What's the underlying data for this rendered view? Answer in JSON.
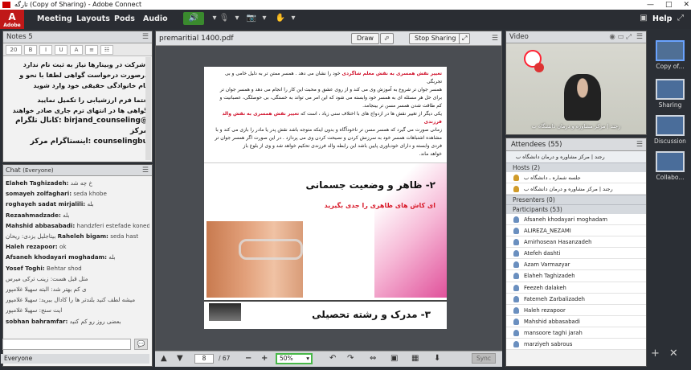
{
  "window": {
    "title": "تارگه (Copy of Sharing) - Adobe Connect",
    "controls": [
      "—",
      "□",
      "✕"
    ]
  },
  "menu": {
    "logo": "Adobe",
    "items": [
      "Meeting",
      "Layouts",
      "Pods",
      "Audio"
    ],
    "help": "Help"
  },
  "notes": {
    "title": "Notes 5",
    "font_size": "20",
    "lines": [
      "،شرکت در وبینارها نیاز به ثبت نام ندارد",
      "درصورت درخواست گواهی لطفا با نحو و",
      "نام خانوادگی حقیقی خود وارد شوید",
      "",
      "حتما فرم ارزشیابی را تکمیل نمایید",
      "گواهی ها در انتهای ترم جاری صادر خواهند",
      "@birjand_counseling :کانال تلگرام مرکز",
      "counselingbu :اینستاگرام مرکز"
    ]
  },
  "chat": {
    "title": "Chat",
    "scope": "(Everyone)",
    "messages": [
      {
        "name": "Elaheh Taghizadeh:",
        "msg": "خ چه شد"
      },
      {
        "name": "somayeh zolfaghari:",
        "msg": "seda khobe"
      },
      {
        "name": "roghayeh sadat mirjalili:",
        "msg": "بله"
      },
      {
        "name": "Rezaahmadzade:",
        "msg": "بله"
      },
      {
        "name": "Mahshid abbasabadi:",
        "msg": "handzferi estefade koned"
      },
      {
        "name": "",
        "msg": "بیتاجلیل یزدی: ریحان"
      },
      {
        "name": "Raheleh bigam:",
        "msg": "seda hast"
      },
      {
        "name": "Haleh rezapoor:",
        "msg": "ok"
      },
      {
        "name": "Afsaneh khodayari moghadam:",
        "msg": "بله"
      },
      {
        "name": "Yosef Toghi:",
        "msg": "Behtar shod"
      },
      {
        "name": "",
        "msg": "مثل قبل هست: زینب ترکی میرس"
      },
      {
        "name": "",
        "msg": "ی کم بهتر شد: البته سهیلا غلامپور"
      },
      {
        "name": "",
        "msg": "میشه لطف کنید بلندتر ها را کادال ببرید: سهیلا غلامپور"
      },
      {
        "name": "",
        "msg": "ایت سنج: سهیلا غلامپور"
      },
      {
        "name": "sobhan bahramfar:",
        "msg": "بعضی روز رو کم کنید"
      }
    ],
    "footer": "Everyone"
  },
  "share": {
    "filename": "premaritial 1400.pdf",
    "draw_label": "Draw",
    "stop_label": "Stop Sharing",
    "page_current": "8",
    "page_total": "/ 67",
    "zoom": "50%",
    "sync_label": "Sync",
    "doc_text": [
      {
        "red": "تغییر نقش همسری به نقش معلم شاگردی",
        "rest": " خود را نشان می دهد . همسر ممتن تر به دلیل خامی و بی تجربگی"
      },
      {
        "red": "",
        "rest": "همسر جوان تر شروع به آموزش وی می کند و از روی عشق و محبت این کار را انجام می دهد و همسر جوان تر"
      },
      {
        "red": "",
        "rest": "برای حل هر مسئله ای به همسر خود وابسته می شود که این امر می تواند به خستگی، بی حوصلگی، عصبانیت و"
      },
      {
        "red": "",
        "rest": "کم طاقت شدن همسر مسن تر بینجامد."
      },
      {
        "red": "تغییر نقش همسری به نقش والد فرزندی",
        "rest": "یکی دیگر از تغییر نقش ها در ازدواج های با اختلاف سنی زیاد ، است که"
      },
      {
        "red": "",
        "rest": "زمانی صورت می گیرد که همسر مسن تر ناخودآگاه و بدون اینکه متوجه باشد نقش پدر یا مادر را بازی می کند و با"
      },
      {
        "red": "",
        "rest": "مشاهده اشتباهات همسر خود به سرزنش کردن و نصیحت کردن وی می پردازد . در این صورت اگر همسر جوان تر"
      },
      {
        "red": "",
        "rest": "فردی وابسته و دارای خودباوری پایین باشد این رابطه والد فرزندی تحکیم خواهد شد و وی از بلوغ باز"
      },
      {
        "red": "",
        "rest": "خواهد ماند."
      }
    ],
    "slide1_title": "۲- ظاهر و وضعیت جسمانی",
    "slide1_sub": "ای کاش های ظاهری را جدی بگیرید",
    "slide2_title": "۳- مدرک و رشته تحصیلی"
  },
  "video": {
    "title": "Video",
    "caption": "رجند | مرکز مشاوره و درمان دانشگاه ب"
  },
  "attendees": {
    "title": "Attendees",
    "count": "(55)",
    "status": "رجند | مرکز مشاوره و درمان دانشگاه ب",
    "hosts_label": "Hosts (2)",
    "hosts": [
      "جلسه شماره ـ دانشگاه ب",
      "رجند | مرکز مشاوره و درمان دانشگاه ب"
    ],
    "presenters_label": "Presenters (0)",
    "participants_label": "Participants (53)",
    "participants": [
      "Afsaneh khodayari moghadam",
      "ALIREZA_NEZAMI",
      "Amirhosean Hasanzadeh",
      "Atefeh dashti",
      "Azam Varmazyar",
      "Elaheh Taghizadeh",
      "Feezeh dalakeh",
      "Fatemeh Zarbalizadeh",
      "Haleh rezapoor",
      "Mahshid abbasabadi",
      "mansoore taghi jarah",
      "marziyeh sabrous"
    ]
  },
  "rail": {
    "items": [
      "Copy of...",
      "Sharing",
      "Discussion",
      "Collabo..."
    ]
  }
}
